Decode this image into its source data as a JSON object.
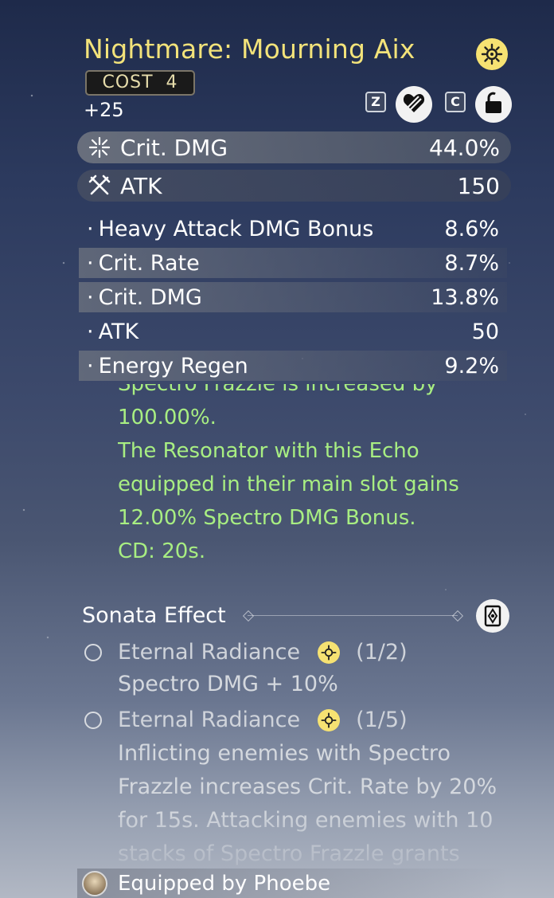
{
  "echo": {
    "name": "Nightmare: Mourning Aix",
    "element_icon": "spectro-sun-icon",
    "cost_label": "COST",
    "cost_value": "4",
    "level": "+25"
  },
  "actions": {
    "lock_key": "Z",
    "lock_icon": "broken-heart-icon",
    "unlock_key": "C",
    "unlock_icon": "padlock-icon"
  },
  "main_stats": [
    {
      "label": "Crit. DMG",
      "value": "44.0%",
      "icon": "crit-burst-icon"
    },
    {
      "label": "ATK",
      "value": "150",
      "icon": "crossed-swords-icon"
    }
  ],
  "sub_stats": [
    {
      "label": "Heavy Attack DMG Bonus",
      "value": "8.6%"
    },
    {
      "label": "Crit. Rate",
      "value": "8.7%"
    },
    {
      "label": "Crit. DMG",
      "value": "13.8%"
    },
    {
      "label": "ATK",
      "value": "50"
    },
    {
      "label": "Energy Regen",
      "value": "9.2%"
    }
  ],
  "bullet": "·",
  "skill_effect": [
    "Spectro Frazzle is increased by",
    "100.00%.",
    "The Resonator with this Echo",
    "equipped in their main slot gains",
    "12.00% Spectro DMG Bonus.",
    "CD: 20s."
  ],
  "sonata": {
    "title": "Sonata Effect",
    "icon": "sonata-card-icon",
    "sets": [
      {
        "name": "Eternal Radiance",
        "count": "(1/2)",
        "icon": "spectro-sun-icon",
        "desc": [
          "Spectro DMG + 10%"
        ]
      },
      {
        "name": "Eternal Radiance",
        "count": "(1/5)",
        "icon": "spectro-sun-icon",
        "desc": [
          "Inflicting enemies with Spectro",
          "Frazzle increases Crit. Rate by 20%",
          "for 15s. Attacking enemies with 10",
          "stacks of Spectro Frazzle grants"
        ]
      }
    ]
  },
  "equipped": {
    "text": "Equipped by Phoebe",
    "avatar": "phoebe-avatar"
  },
  "colors": {
    "title": "#f3e37a",
    "effect": "#a8ee82",
    "spectro": "#f6e272"
  }
}
